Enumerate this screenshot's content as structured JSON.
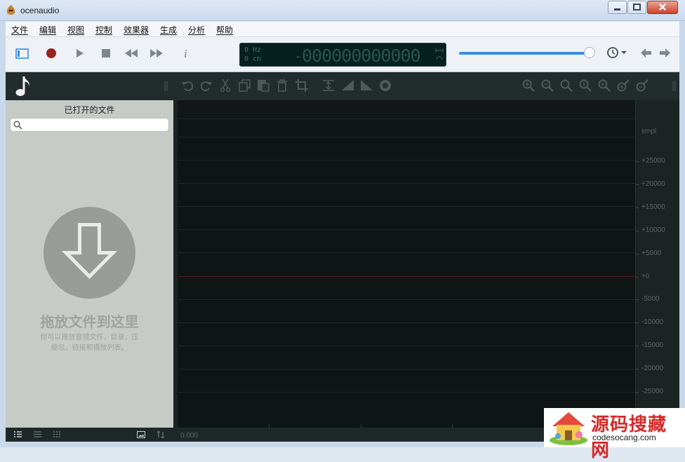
{
  "window": {
    "title": "ocenaudio"
  },
  "menu": [
    "文件",
    "编辑",
    "视图",
    "控制",
    "效果器",
    "生成",
    "分析",
    "帮助"
  ],
  "display": {
    "rate": "0 Hz",
    "channels": "0 ch",
    "sign": "-",
    "time": "000000000000"
  },
  "sidebar": {
    "title": "已打开的文件",
    "search_placeholder": "",
    "drop_title": "拖放文件到这里",
    "drop_hint_line1": "你可以拖放音频文件，目录，压",
    "drop_hint_line2": "缩包，链接和播放列表。"
  },
  "scale": {
    "unit": "smpl",
    "labels": [
      "+25000",
      "+20000",
      "+15000",
      "+10000",
      "+5000",
      "+0",
      "-5000",
      "-10000",
      "-15000",
      "-20000",
      "-25000"
    ]
  },
  "timeline": {
    "start": "0.000"
  },
  "colors": {
    "accent": "#3a8fe0",
    "record": "#9b2222",
    "background": "#1a2323"
  },
  "watermark": {
    "title": "源码搜藏网",
    "url": "codesocang.com"
  }
}
